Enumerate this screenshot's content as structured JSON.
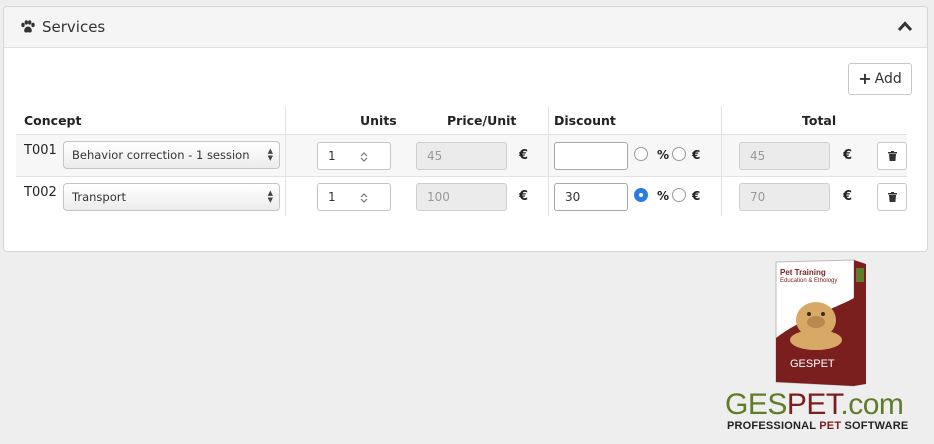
{
  "panel": {
    "title": "Services",
    "icon": "paw-icon",
    "collapse_icon": "chevron-up-icon"
  },
  "toolbar": {
    "add_label": "Add"
  },
  "table": {
    "headers": {
      "concept": "Concept",
      "units": "Units",
      "price_unit": "Price/Unit",
      "discount": "Discount",
      "total": "Total"
    },
    "rows": [
      {
        "code": "T001",
        "concept": "Behavior correction - 1 session",
        "units": "1",
        "price": "45",
        "currency": "€",
        "discount": "",
        "pct_symbol": "%",
        "eur_symbol": "€",
        "discount_type": "none",
        "total": "45",
        "total_currency": "€"
      },
      {
        "code": "T002",
        "concept": "Transport",
        "units": "1",
        "price": "100",
        "currency": "€",
        "discount": "30",
        "pct_symbol": "%",
        "eur_symbol": "€",
        "discount_type": "percent",
        "total": "70",
        "total_currency": "€"
      }
    ]
  },
  "logo": {
    "box_title": "Pet Training",
    "box_subtitle": "Education & Ethology",
    "box_brand": "GESPET",
    "brand_part1": "GES",
    "brand_part2": "PET",
    "brand_part3": ".com",
    "tagline_part1": "PROFESSIONAL ",
    "tagline_part2": "PET",
    "tagline_part3": " SOFTWARE",
    "colors": {
      "green": "#5f7d29",
      "maroon": "#7a1e1e"
    }
  },
  "colors": {
    "accent": "#2a7de1",
    "panel_head": "#f5f5f5",
    "row_stripe": "#f7f7f7"
  }
}
